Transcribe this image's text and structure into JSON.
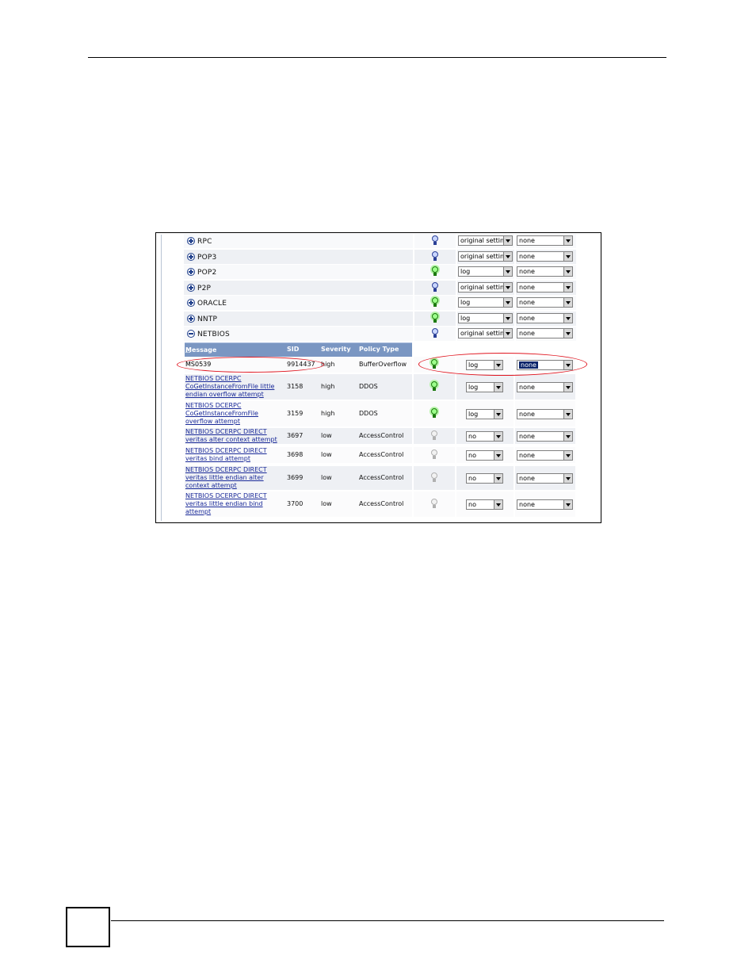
{
  "categories": [
    {
      "name": "RPC",
      "expanded": false,
      "status_icon": "blue-bulb-icon",
      "action": "original setting",
      "log": "none"
    },
    {
      "name": "POP3",
      "expanded": false,
      "status_icon": "blue-bulb-icon",
      "action": "original setting",
      "log": "none"
    },
    {
      "name": "POP2",
      "expanded": false,
      "status_icon": "green-bulb-icon",
      "action": "log",
      "log": "none"
    },
    {
      "name": "P2P",
      "expanded": false,
      "status_icon": "blue-bulb-icon",
      "action": "original setting",
      "log": "none"
    },
    {
      "name": "ORACLE",
      "expanded": false,
      "status_icon": "green-bulb-icon",
      "action": "log",
      "log": "none"
    },
    {
      "name": "NNTP",
      "expanded": false,
      "status_icon": "green-bulb-icon",
      "action": "log",
      "log": "none"
    },
    {
      "name": "NETBIOS",
      "expanded": true,
      "status_icon": "blue-bulb-icon",
      "action": "original setting",
      "log": "none"
    }
  ],
  "table_header": {
    "message": "Message",
    "sid": "SID",
    "severity": "Severity",
    "policy_type": "Policy Type"
  },
  "rules": [
    {
      "message": [
        "MS0539"
      ],
      "link": false,
      "sid": "9914437",
      "severity": "high",
      "policy_type": "BufferOverflow",
      "status_icon": "green-bulb-icon",
      "action": "log",
      "log": "none",
      "log_highlighted": true
    },
    {
      "message": [
        "NETBIOS DCERPC",
        "CoGetInstanceFromFile little",
        "endian overflow attempt"
      ],
      "link": true,
      "sid": "3158",
      "severity": "high",
      "policy_type": "DDOS",
      "status_icon": "green-bulb-icon",
      "action": "log",
      "log": "none"
    },
    {
      "message": [
        "NETBIOS DCERPC",
        "CoGetInstanceFromFile",
        "overflow attempt"
      ],
      "link": true,
      "sid": "3159",
      "severity": "high",
      "policy_type": "DDOS",
      "status_icon": "green-bulb-icon",
      "action": "log",
      "log": "none"
    },
    {
      "message": [
        "NETBIOS DCERPC DIRECT",
        "veritas alter context attempt"
      ],
      "link": true,
      "sid": "3697",
      "severity": "low",
      "policy_type": "AccessControl",
      "status_icon": "gray-bulb-icon",
      "action": "no",
      "log": "none"
    },
    {
      "message": [
        "NETBIOS DCERPC DIRECT",
        "veritas bind attempt"
      ],
      "link": true,
      "sid": "3698",
      "severity": "low",
      "policy_type": "AccessControl",
      "status_icon": "gray-bulb-icon",
      "action": "no",
      "log": "none"
    },
    {
      "message": [
        "NETBIOS DCERPC DIRECT",
        "veritas little endian alter",
        "context attempt"
      ],
      "link": true,
      "sid": "3699",
      "severity": "low",
      "policy_type": "AccessControl",
      "status_icon": "gray-bulb-icon",
      "action": "no",
      "log": "none"
    },
    {
      "message": [
        "NETBIOS DCERPC DIRECT",
        "veritas little endian bind",
        "attempt"
      ],
      "link": true,
      "sid": "3700",
      "severity": "low",
      "policy_type": "AccessControl",
      "status_icon": "gray-bulb-icon",
      "action": "no",
      "log": "none"
    }
  ],
  "colors": {
    "header_bg": "#7a96c2",
    "link": "#1a2a99",
    "callout": "#e0141e",
    "selected_option": "#0a246a"
  }
}
